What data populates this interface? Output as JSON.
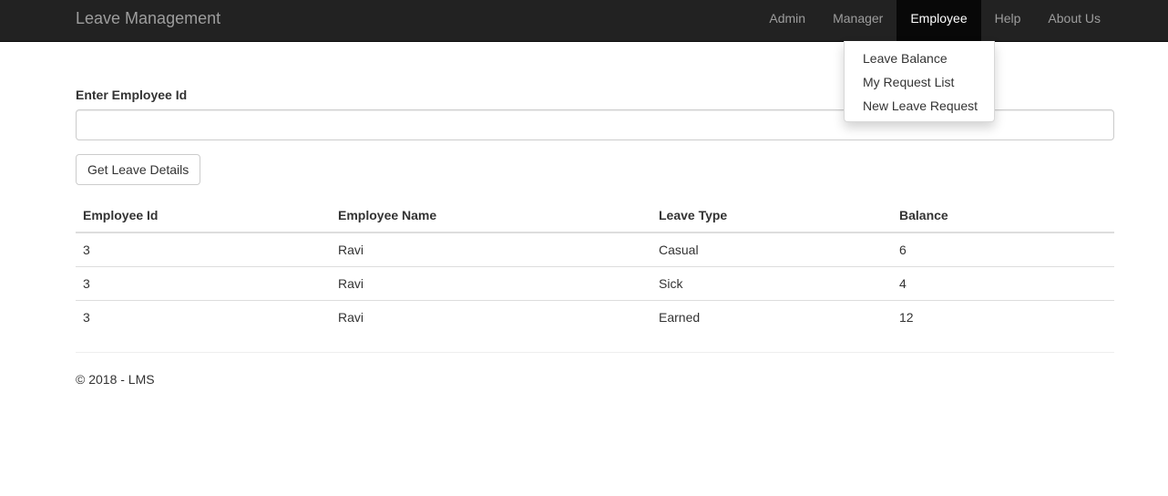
{
  "navbar": {
    "brand": "Leave Management",
    "items": [
      {
        "label": "Admin"
      },
      {
        "label": "Manager"
      },
      {
        "label": "Employee"
      },
      {
        "label": "Help"
      },
      {
        "label": "About Us"
      }
    ]
  },
  "dropdown": {
    "items": [
      {
        "label": "Leave Balance"
      },
      {
        "label": "My Request List"
      },
      {
        "label": "New Leave Request"
      }
    ]
  },
  "form": {
    "label": "Enter Employee Id",
    "value": "",
    "button_label": "Get Leave Details"
  },
  "table": {
    "headers": [
      "Employee Id",
      "Employee Name",
      "Leave Type",
      "Balance"
    ],
    "rows": [
      [
        "3",
        "Ravi",
        "Casual",
        "6"
      ],
      [
        "3",
        "Ravi",
        "Sick",
        "4"
      ],
      [
        "3",
        "Ravi",
        "Earned",
        "12"
      ]
    ]
  },
  "footer": {
    "text": "© 2018 - LMS"
  }
}
